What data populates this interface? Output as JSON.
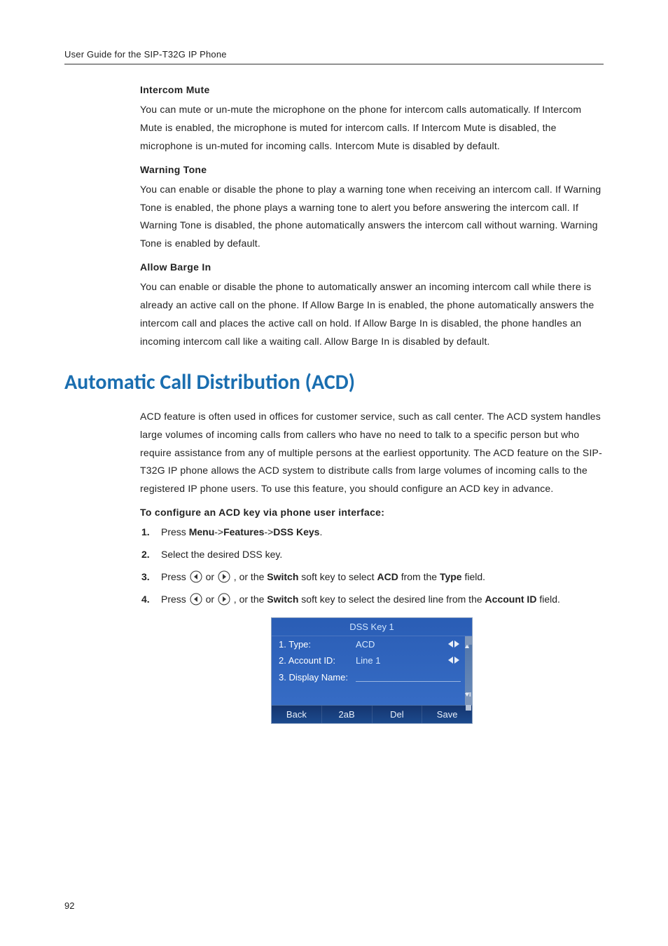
{
  "header": "User Guide for the SIP-T32G IP Phone",
  "page_number": "92",
  "sections": {
    "intercom_mute": {
      "title": "Intercom Mute",
      "text": "You can mute or un-mute the microphone on the phone for intercom calls automatically. If Intercom Mute is enabled, the microphone is muted for intercom calls. If Intercom Mute is disabled, the microphone is un-muted for incoming calls. Intercom Mute is disabled by default."
    },
    "warning_tone": {
      "title": "Warning Tone",
      "text": "You can enable or disable the phone to play a warning tone when receiving an intercom call. If Warning Tone is enabled, the phone plays a warning tone to alert you before answering the intercom call. If Warning Tone is disabled, the phone automatically answers the intercom call without warning. Warning Tone is enabled by default."
    },
    "allow_barge_in": {
      "title": "Allow Barge In",
      "text": "You can enable or disable the phone to automatically answer an incoming intercom call while there is already an active call on the phone. If Allow Barge In is enabled, the phone automatically answers the intercom call and places the active call on hold. If Allow Barge In is disabled, the phone handles an incoming intercom call like a waiting call. Allow Barge In is disabled by default."
    },
    "acd": {
      "heading": "Automatic Call Distribution (ACD)",
      "intro": "ACD feature is often used in offices for customer service, such as call center. The ACD system handles large volumes of incoming calls from callers who have no need to talk to a specific person but who require assistance from any of multiple persons at the earliest opportunity. The ACD feature on the SIP-T32G IP phone allows the ACD system to distribute calls from large volumes of incoming calls to the registered IP phone users. To use this feature, you should configure an ACD key in advance.",
      "procedure_title": "To configure an ACD key via phone user interface:",
      "steps": {
        "s1_pre": "Press ",
        "s1_menu": "Menu",
        "s1_sep1": "->",
        "s1_features": "Features",
        "s1_sep2": "->",
        "s1_dsskeys": "DSS Keys",
        "s1_post": ".",
        "s2": "Select the desired DSS key.",
        "s3_pre": "Press ",
        "s3_or": " or ",
        "s3_mid1": " , or the ",
        "s3_switch": "Switch",
        "s3_mid2": " soft key to select ",
        "s3_acd": "ACD",
        "s3_mid3": " from the ",
        "s3_type": "Type",
        "s3_post": " field.",
        "s4_pre": "Press ",
        "s4_or": " or ",
        "s4_mid1": " , or the ",
        "s4_switch": "Switch",
        "s4_mid2": " soft key to select the desired line from the ",
        "s4_account": "Account ID",
        "s4_post": " field."
      }
    }
  },
  "phone_screen": {
    "title": "DSS Key 1",
    "rows": [
      {
        "label": "1. Type:",
        "value": "ACD",
        "arrows": true
      },
      {
        "label": "2. Account ID:",
        "value": "Line 1",
        "arrows": true
      },
      {
        "label": "3. Display Name:",
        "value": "",
        "arrows": false
      }
    ],
    "softkeys": [
      "Back",
      "2aB",
      "Del",
      "Save"
    ]
  }
}
